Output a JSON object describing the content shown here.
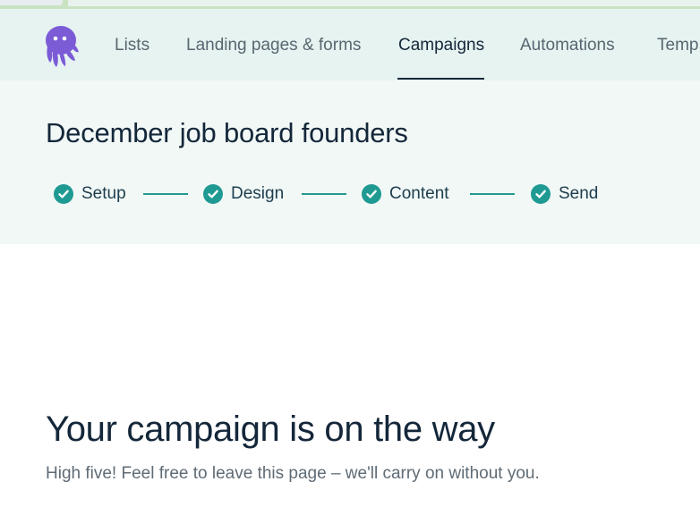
{
  "nav": {
    "items": [
      {
        "label": "Lists"
      },
      {
        "label": "Landing pages & forms"
      },
      {
        "label": "Campaigns"
      },
      {
        "label": "Automations"
      },
      {
        "label": "Temp"
      }
    ],
    "active": "Campaigns",
    "logo_icon": "octopus-logo-icon",
    "logo_color": "#7b5bd6"
  },
  "campaign": {
    "title": "December job board founders"
  },
  "steps": [
    {
      "label": "Setup",
      "status": "complete"
    },
    {
      "label": "Design",
      "status": "complete"
    },
    {
      "label": "Content",
      "status": "complete"
    },
    {
      "label": "Send",
      "status": "complete"
    }
  ],
  "colors": {
    "accent": "#1f9a93",
    "text_dark": "#14273a",
    "nav_bg": "#e6f3f1",
    "header_bg": "#f1f8f6"
  },
  "success": {
    "title": "Your campaign is on the way",
    "message": "High five! Feel free to leave this page – we'll carry on without you."
  }
}
